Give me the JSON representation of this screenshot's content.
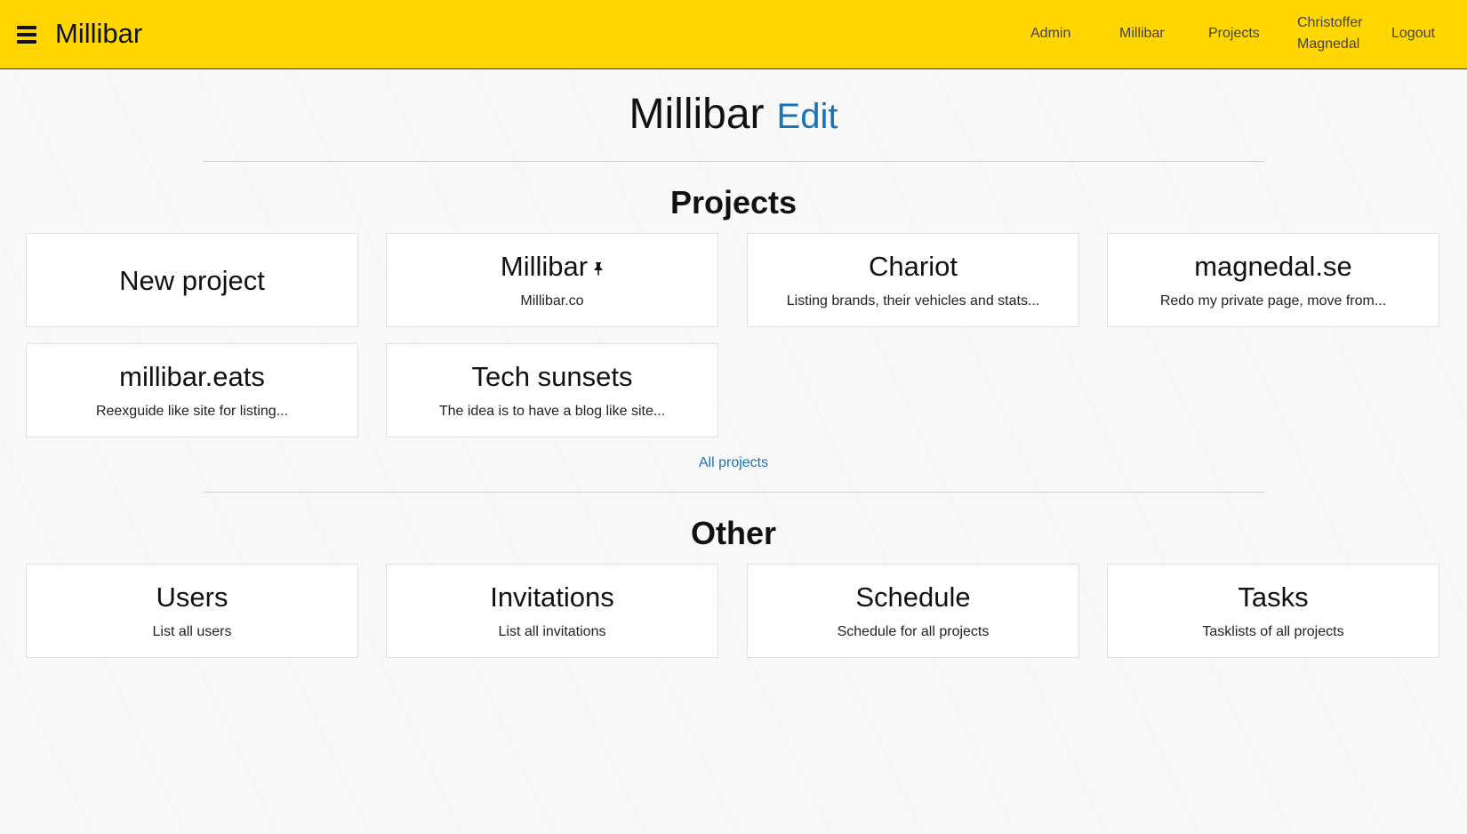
{
  "navbar": {
    "brand": "Millibar",
    "links": {
      "admin": "Admin",
      "millibar": "Millibar",
      "projects": "Projects",
      "user_first": "Christoffer",
      "user_last": "Magnedal",
      "logout": "Logout"
    }
  },
  "header": {
    "title": "Millibar",
    "edit_label": "Edit"
  },
  "projects_section": {
    "title": "Projects",
    "new_project_label": "New project",
    "items": [
      {
        "title": "Millibar",
        "description": "Millibar.co",
        "pinned": true
      },
      {
        "title": "Chariot",
        "description": "Listing brands, their vehicles and stats..."
      },
      {
        "title": "magnedal.se",
        "description": "Redo my private page, move from..."
      },
      {
        "title": "millibar.eats",
        "description": "Reexguide like site for listing..."
      },
      {
        "title": "Tech sunsets",
        "description": "The idea is to have a blog like site..."
      }
    ],
    "all_projects_label": "All projects"
  },
  "other_section": {
    "title": "Other",
    "items": [
      {
        "title": "Users",
        "description": "List all users"
      },
      {
        "title": "Invitations",
        "description": "List all invitations"
      },
      {
        "title": "Schedule",
        "description": "Schedule for all projects"
      },
      {
        "title": "Tasks",
        "description": "Tasklists of all projects"
      }
    ]
  },
  "colors": {
    "navbar_bg": "#ffd600",
    "link": "#1a73b8",
    "page_bg": "#f8f8f8"
  },
  "icons": {
    "menu": "hamburger-menu-icon",
    "pin": "pushpin-icon"
  }
}
